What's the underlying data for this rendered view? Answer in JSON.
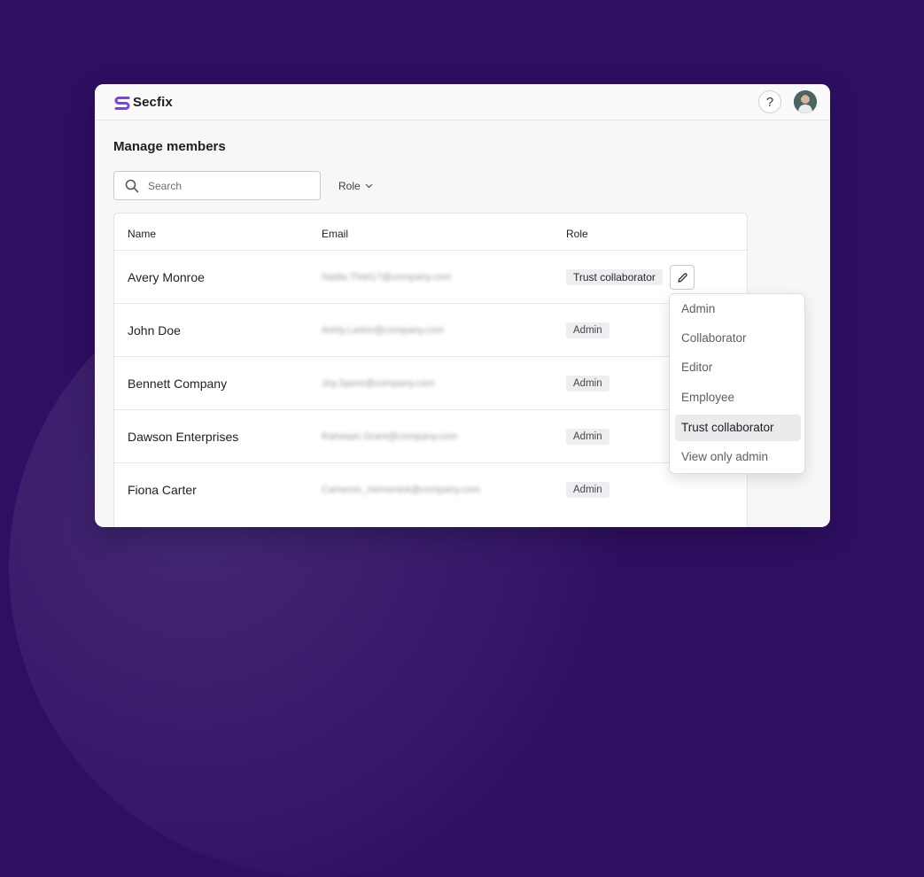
{
  "app": {
    "name": "Secfix",
    "brand_color": "#7b3ff2"
  },
  "header": {
    "help_label": "?",
    "help_icon": "question-icon",
    "avatar_icon": "user-avatar"
  },
  "page": {
    "title": "Manage members"
  },
  "search": {
    "placeholder": "Search",
    "value": ""
  },
  "filter": {
    "role_label": "Role"
  },
  "table": {
    "columns": {
      "name": "Name",
      "email": "Email",
      "role": "Role"
    },
    "rows": [
      {
        "name": "Avery Monroe",
        "email": "Nadia.Thiel17@company.com",
        "role": "Trust collaborator"
      },
      {
        "name": "John Doe",
        "email": "Ashly.Larkin@company.com",
        "role": "Admin"
      },
      {
        "name": "Bennett Company",
        "email": "Joy.Spore@company.com",
        "role": "Admin"
      },
      {
        "name": "Dawson Enterprises",
        "email": "Rahsaan.Grant@company.com",
        "role": "Admin"
      },
      {
        "name": "Fiona Carter",
        "email": "Cameron_Homenick@company.com",
        "role": "Admin"
      }
    ]
  },
  "role_menu": {
    "options": [
      "Admin",
      "Collaborator",
      "Editor",
      "Employee",
      "Trust collaborator",
      "View only admin"
    ],
    "selected": "Trust collaborator"
  }
}
